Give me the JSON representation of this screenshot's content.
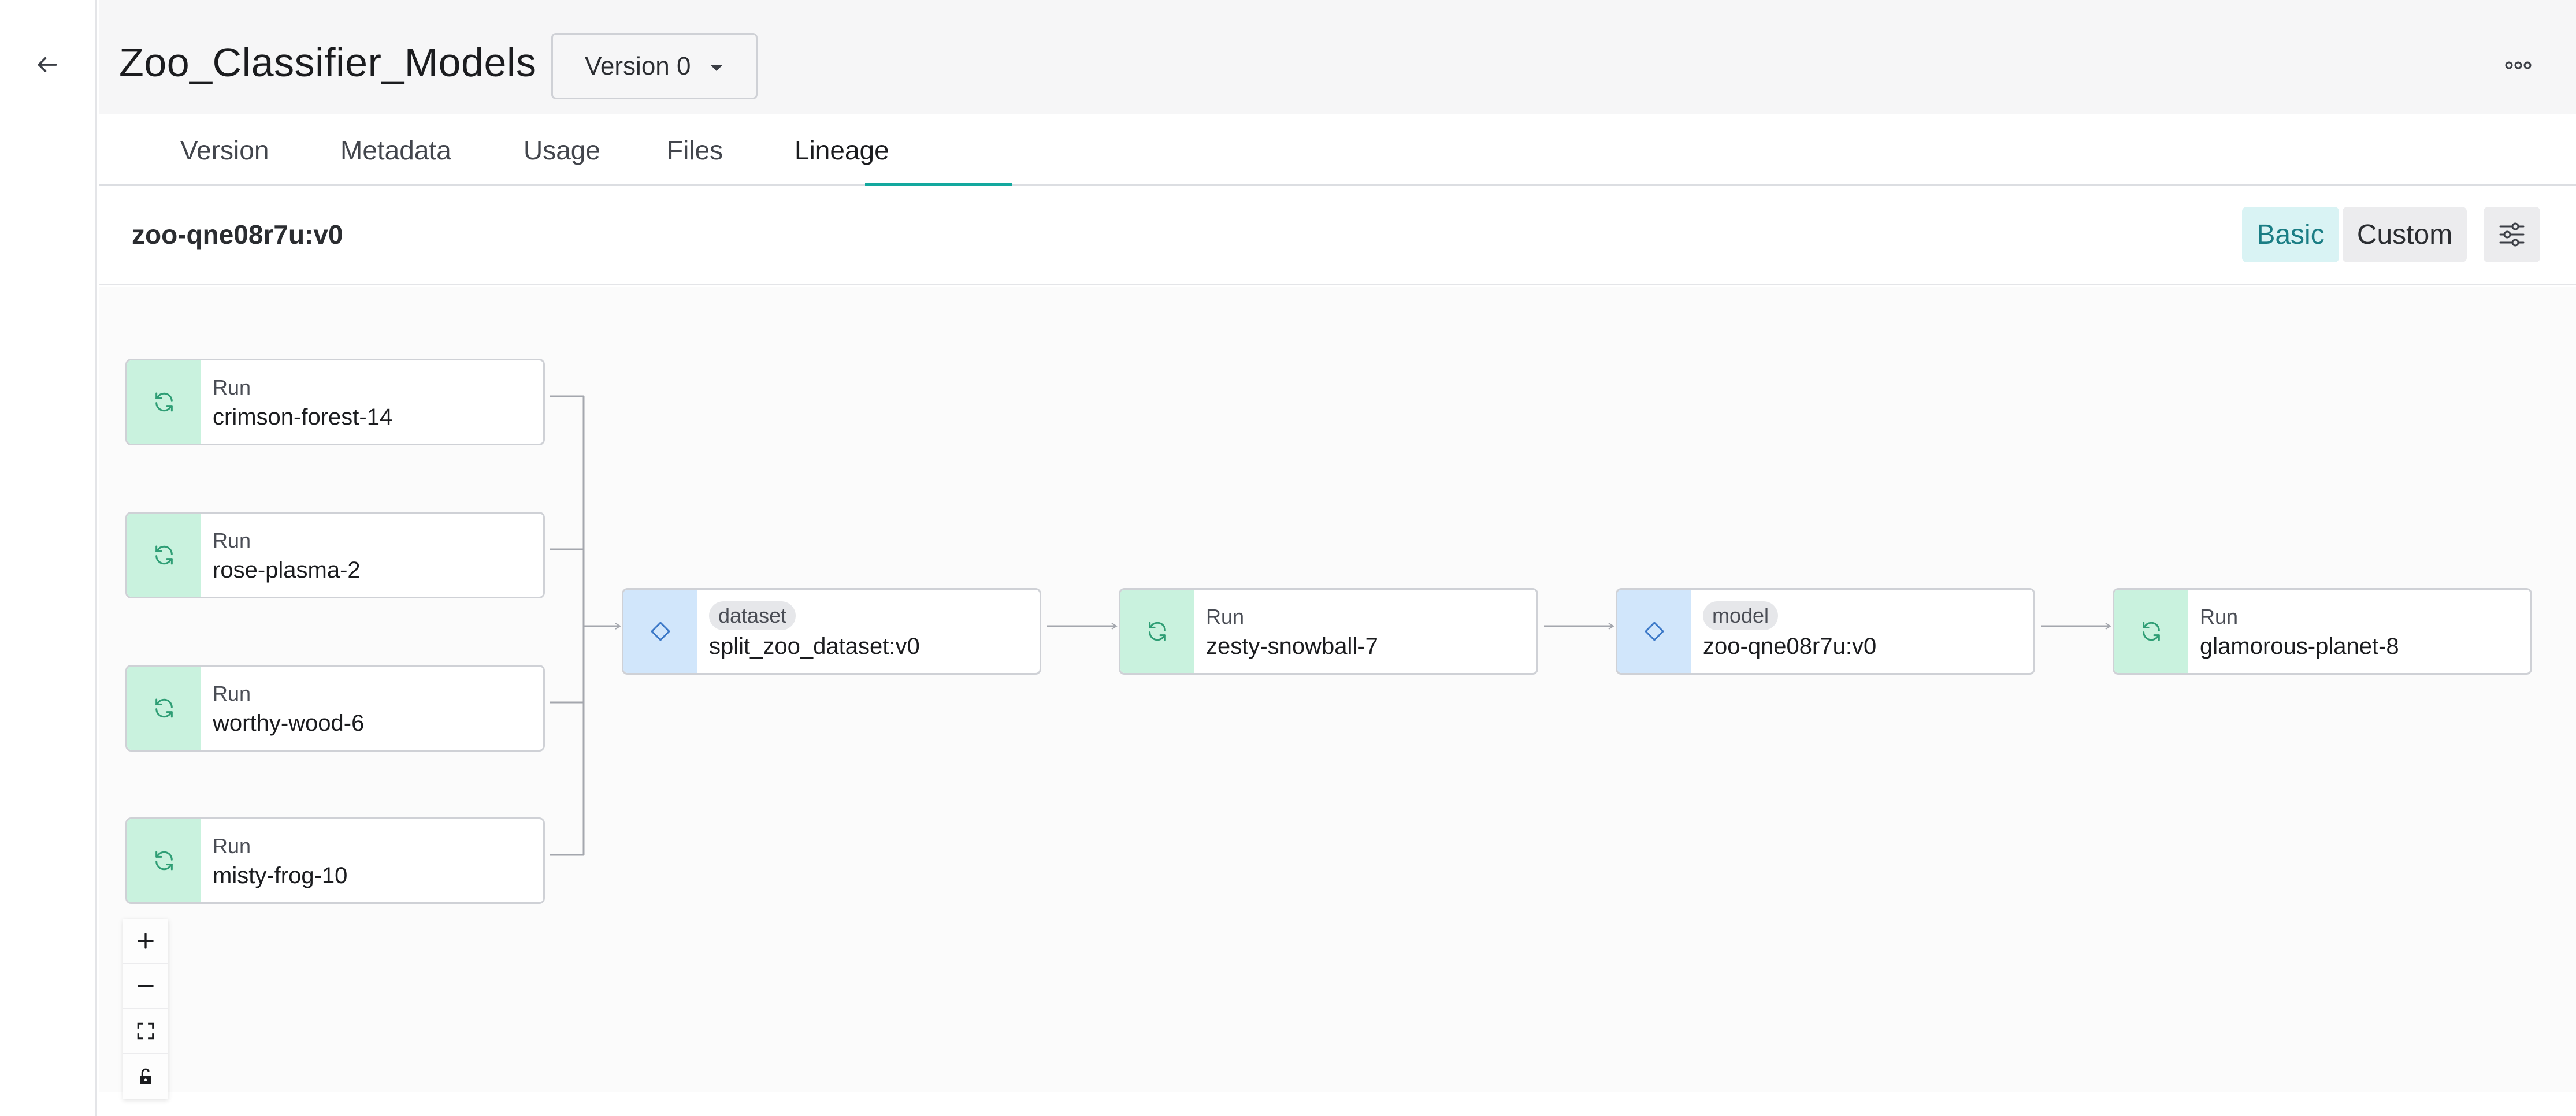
{
  "header": {
    "title": "Zoo_Classifier_Models",
    "version_select": {
      "label": "Version 0"
    }
  },
  "tabs": [
    {
      "label": "Version"
    },
    {
      "label": "Metadata"
    },
    {
      "label": "Usage"
    },
    {
      "label": "Files"
    },
    {
      "label": "Lineage",
      "active": true
    }
  ],
  "subheader": {
    "artifact_title": "zoo-qne08r7u:v0",
    "modes": {
      "basic": "Basic",
      "custom": "Custom"
    },
    "active_mode": "basic"
  },
  "lineage": {
    "inputs": [
      {
        "type": "Run",
        "name": "crimson-forest-14"
      },
      {
        "type": "Run",
        "name": "rose-plasma-2"
      },
      {
        "type": "Run",
        "name": "worthy-wood-6"
      },
      {
        "type": "Run",
        "name": "misty-frog-10"
      }
    ],
    "chain": [
      {
        "kind": "artifact",
        "type": "dataset",
        "name": "split_zoo_dataset:v0"
      },
      {
        "kind": "run",
        "type": "Run",
        "name": "zesty-snowball-7"
      },
      {
        "kind": "artifact",
        "type": "model",
        "name": "zoo-qne08r7u:v0"
      },
      {
        "kind": "run",
        "type": "Run",
        "name": "glamorous-planet-8"
      }
    ]
  },
  "colors": {
    "accent": "#13a89e",
    "run_icon_bg": "#c9f2de",
    "artifact_icon_bg": "#d1e6fb",
    "basic_active_bg": "#d9f3f4"
  },
  "icons": {
    "back": "arrow-left-icon",
    "more": "more-horizontal-icon",
    "dropdown": "caret-down-icon",
    "settings": "sliders-icon",
    "run": "refresh-icon",
    "artifact": "diamond-icon",
    "zoom_in": "plus-icon",
    "zoom_out": "minus-icon",
    "fit": "fit-view-icon",
    "lock": "unlock-icon"
  }
}
